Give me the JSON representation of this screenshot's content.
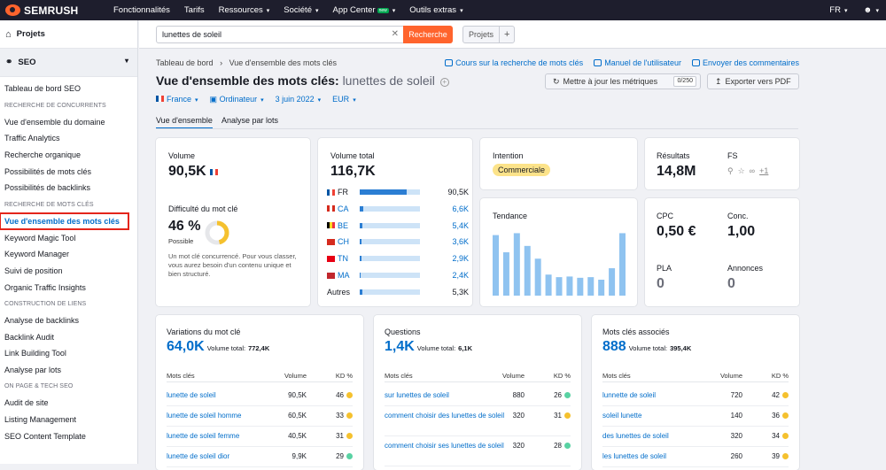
{
  "topnav": {
    "brand": "SEMRUSH",
    "items": [
      {
        "label": "Fonctionnalités",
        "chev": false
      },
      {
        "label": "Tarifs",
        "chev": false
      },
      {
        "label": "Ressources",
        "chev": true
      },
      {
        "label": "Société",
        "chev": true
      },
      {
        "label": "App Center",
        "chev": true,
        "badge": "new"
      },
      {
        "label": "Outils extras",
        "chev": true
      }
    ],
    "lang": "FR"
  },
  "sidebar": {
    "projects": "Projets",
    "seo": "SEO",
    "items": [
      {
        "type": "item",
        "label": "Tableau de bord SEO"
      },
      {
        "type": "head",
        "label": "RECHERCHE DE CONCURRENTS"
      },
      {
        "type": "item",
        "label": "Vue d'ensemble du domaine"
      },
      {
        "type": "item",
        "label": "Traffic Analytics"
      },
      {
        "type": "item",
        "label": "Recherche organique"
      },
      {
        "type": "item",
        "label": "Possibilités de mots clés"
      },
      {
        "type": "item",
        "label": "Possibilités de backlinks"
      },
      {
        "type": "head",
        "label": "RECHERCHE DE MOTS CLÉS"
      },
      {
        "type": "item",
        "label": "Vue d'ensemble des mots clés",
        "active": true
      },
      {
        "type": "item",
        "label": "Keyword Magic Tool"
      },
      {
        "type": "item",
        "label": "Keyword Manager"
      },
      {
        "type": "item",
        "label": "Suivi de position"
      },
      {
        "type": "item",
        "label": "Organic Traffic Insights"
      },
      {
        "type": "head",
        "label": "CONSTRUCTION DE LIENS"
      },
      {
        "type": "item",
        "label": "Analyse de backlinks"
      },
      {
        "type": "item",
        "label": "Backlink Audit"
      },
      {
        "type": "item",
        "label": "Link Building Tool"
      },
      {
        "type": "item",
        "label": "Analyse par lots"
      },
      {
        "type": "head",
        "label": "ON PAGE & TECH SEO"
      },
      {
        "type": "item",
        "label": "Audit de site"
      },
      {
        "type": "item",
        "label": "Listing Management"
      },
      {
        "type": "item",
        "label": "SEO Content Template"
      }
    ]
  },
  "search": {
    "value": "lunettes de soleil",
    "button": "Recherche",
    "projects": "Projets"
  },
  "header": {
    "breadcrumb1": "Tableau de bord",
    "breadcrumb2": "Vue d'ensemble des mots clés",
    "link1": "Cours sur la recherche de mots clés",
    "link2": "Manuel de l'utilisateur",
    "link3": "Envoyer des commentaires",
    "title": "Vue d'ensemble des mots clés:",
    "keyword": "lunettes de soleil",
    "update": "Mettre à jour les métriques",
    "update_count": "0/250",
    "export": "Exporter vers PDF",
    "country": "France",
    "device": "Ordinateur",
    "date": "3 juin 2022",
    "currency": "EUR",
    "tab1": "Vue d'ensemble",
    "tab2": "Analyse par lots"
  },
  "volume": {
    "label": "Volume",
    "value": "90,5K",
    "kd_label": "Difficulté du mot clé",
    "kd_value": "46 %",
    "kd_text": "Possible",
    "kd_pct": 46,
    "desc": "Un mot clé concurrencé. Pour vous classer, vous aurez besoin d'un contenu unique et bien structuré."
  },
  "total": {
    "label": "Volume total",
    "value": "116,7K",
    "rows": [
      {
        "code": "FR",
        "val": "90,5K",
        "pct": 0.78,
        "c": [
          "#0055a4",
          "#fff",
          "#ef4135"
        ]
      },
      {
        "code": "CA",
        "val": "6,6K",
        "pct": 0.06,
        "c": [
          "#d52b1e",
          "#fff",
          "#d52b1e"
        ]
      },
      {
        "code": "BE",
        "val": "5,4K",
        "pct": 0.05,
        "c": [
          "#000",
          "#fdda24",
          "#ef3340"
        ]
      },
      {
        "code": "CH",
        "val": "3,6K",
        "pct": 0.03,
        "c": [
          "#d52b1e",
          "#d52b1e",
          "#d52b1e"
        ]
      },
      {
        "code": "TN",
        "val": "2,9K",
        "pct": 0.025,
        "c": [
          "#e70013",
          "#e70013",
          "#e70013"
        ]
      },
      {
        "code": "MA",
        "val": "2,4K",
        "pct": 0.02,
        "c": [
          "#c1272d",
          "#c1272d",
          "#c1272d"
        ]
      }
    ],
    "other_label": "Autres",
    "other_val": "5,3K",
    "other_pct": 0.045
  },
  "intent": {
    "label": "Intention",
    "value": "Commerciale"
  },
  "trend": {
    "label": "Tendance",
    "values": [
      0.95,
      0.68,
      0.98,
      0.78,
      0.58,
      0.33,
      0.29,
      0.3,
      0.28,
      0.29,
      0.25,
      0.43,
      0.98
    ]
  },
  "results": {
    "label": "Résultats",
    "value": "14,8M",
    "fs_label": "FS",
    "fs_more": "+1"
  },
  "cpc": {
    "label": "CPC",
    "value": "0,50 €",
    "conc_label": "Conc.",
    "conc_value": "1,00",
    "pla_label": "PLA",
    "pla_value": "0",
    "ads_label": "Annonces",
    "ads_value": "0"
  },
  "cols": {
    "kw": "Mots clés",
    "vol": "Volume",
    "kd": "KD %"
  },
  "variations": {
    "title": "Variations du mot clé",
    "value": "64,0K",
    "total_label": "Volume total:",
    "total": "772,4K",
    "rows": [
      {
        "k": "lunette de soleil",
        "v": "90,5K",
        "kd": "46",
        "c": "#f5c12e"
      },
      {
        "k": "lunette de soleil homme",
        "v": "60,5K",
        "kd": "33",
        "c": "#f5c12e"
      },
      {
        "k": "lunette de soleil femme",
        "v": "40,5K",
        "kd": "31",
        "c": "#f5c12e"
      },
      {
        "k": "lunette de soleil dior",
        "v": "9,9K",
        "kd": "29",
        "c": "#59d2a3"
      }
    ]
  },
  "questions": {
    "title": "Questions",
    "value": "1,4K",
    "total_label": "Volume total:",
    "total": "6,1K",
    "rows": [
      {
        "k": "sur lunettes de soleil",
        "v": "880",
        "kd": "26",
        "c": "#59d2a3"
      },
      {
        "k": "comment choisir des lunettes de soleil",
        "v": "320",
        "kd": "31",
        "c": "#f5c12e"
      },
      {
        "k": "comment choisir ses lunettes de soleil",
        "v": "320",
        "kd": "28",
        "c": "#59d2a3"
      }
    ]
  },
  "related": {
    "title": "Mots clés associés",
    "value": "888",
    "total_label": "Volume total:",
    "total": "395,4K",
    "rows": [
      {
        "k": "lunnette de soleil",
        "v": "720",
        "kd": "42",
        "c": "#f5c12e"
      },
      {
        "k": "soleil lunette",
        "v": "140",
        "kd": "36",
        "c": "#f5c12e"
      },
      {
        "k": "des lunettes de soleil",
        "v": "320",
        "kd": "34",
        "c": "#f5c12e"
      },
      {
        "k": "les lunettes de soleil",
        "v": "260",
        "kd": "39",
        "c": "#f5c12e"
      }
    ]
  }
}
